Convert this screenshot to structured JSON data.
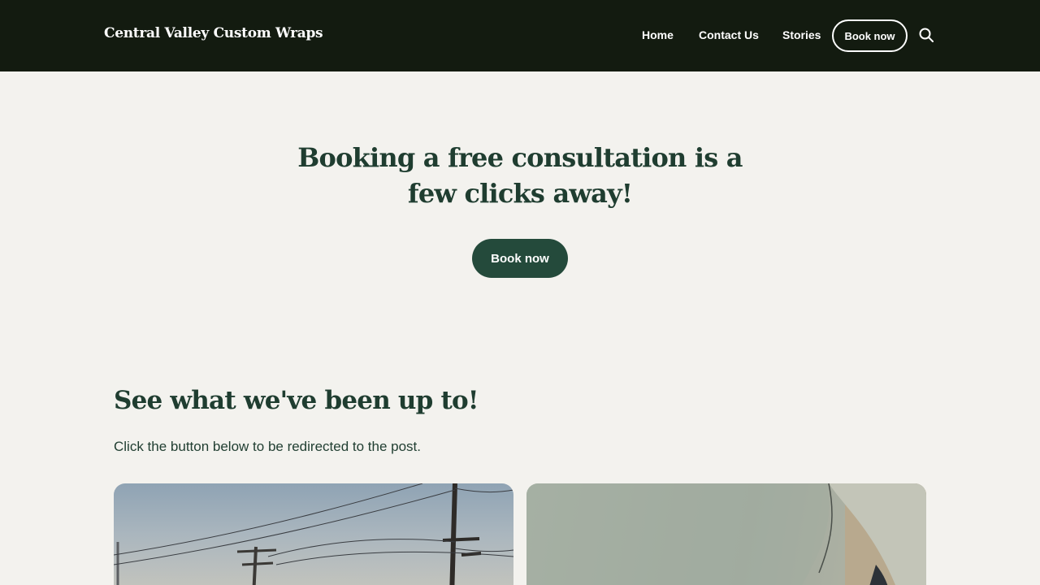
{
  "header": {
    "brand": "Central Valley Custom Wraps",
    "nav": {
      "home": "Home",
      "contact": "Contact Us",
      "stories": "Stories",
      "book": "Book now"
    },
    "search_icon": "search-icon"
  },
  "hero": {
    "title_line1": "Booking a free consultation is a",
    "title_line2": "few clicks away!",
    "button": "Book now"
  },
  "stories": {
    "title": "See what we've been up to!",
    "subtitle": "Click the button below to be redirected to the post."
  },
  "colors": {
    "header_bg": "#131b10",
    "page_bg": "#f3f2ee",
    "accent": "#244a3b",
    "heading": "#1f3d30"
  }
}
